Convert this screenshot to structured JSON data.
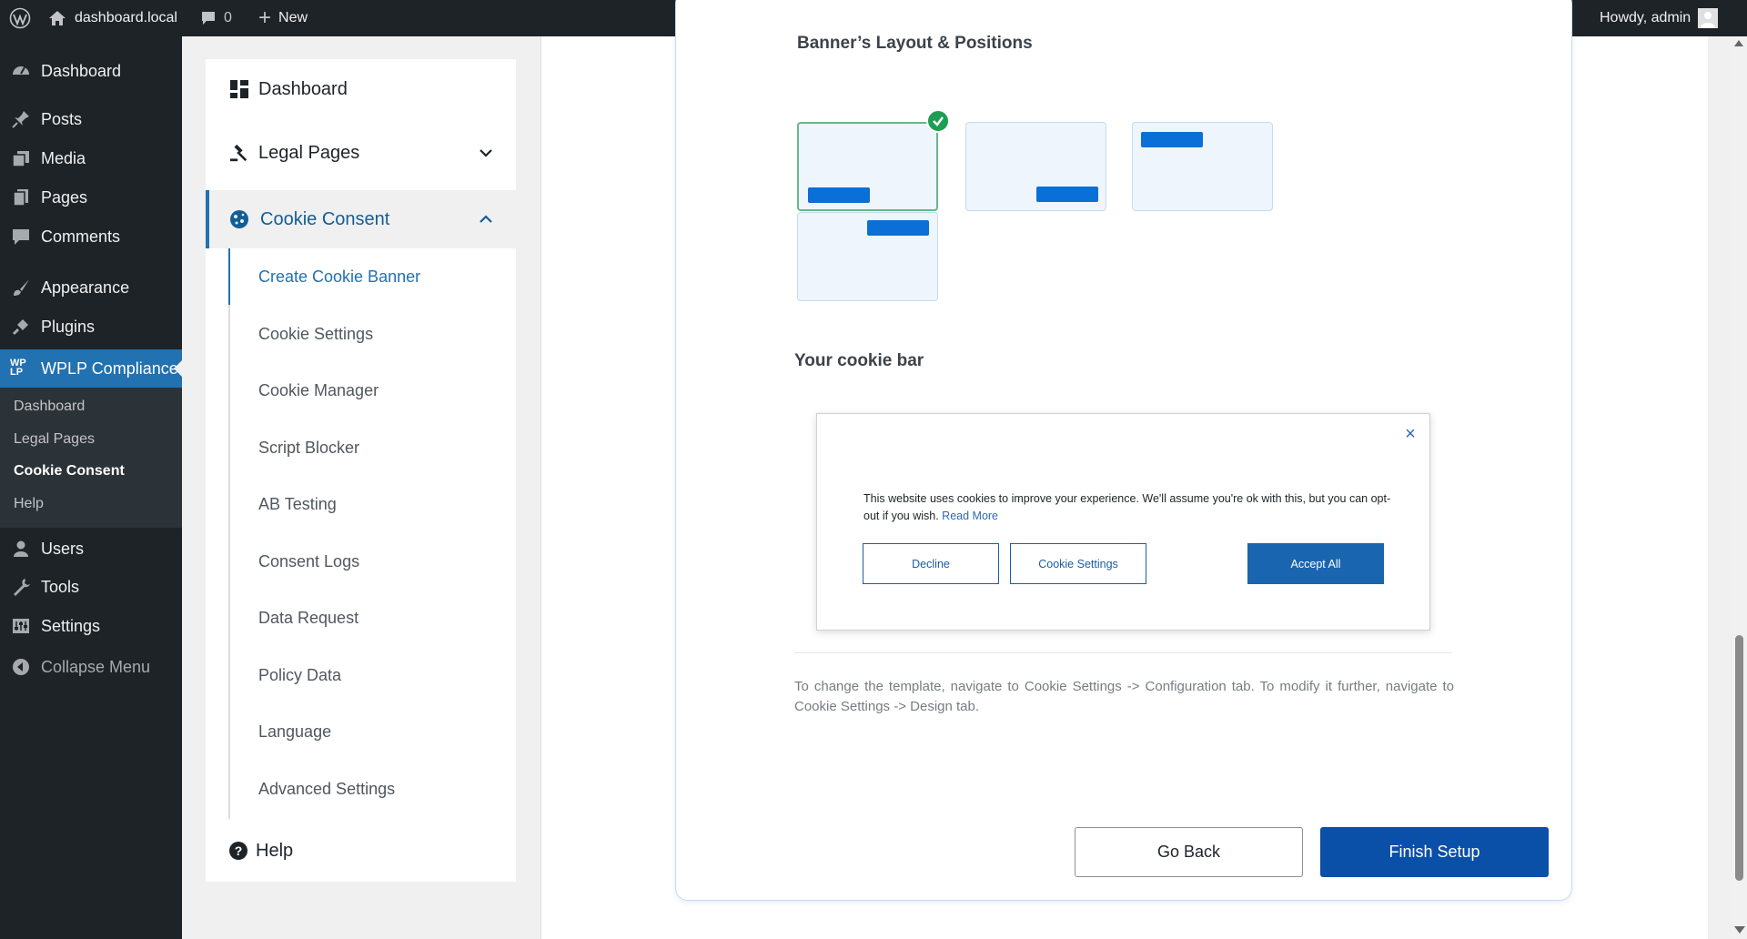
{
  "adminbar": {
    "site_name": "dashboard.local",
    "comments_count": "0",
    "new_label": "New",
    "howdy": "Howdy, admin"
  },
  "sidebar": {
    "items": [
      {
        "label": "Dashboard",
        "icon": "dashboard-icon"
      },
      {
        "label": "Posts",
        "icon": "pin-icon"
      },
      {
        "label": "Media",
        "icon": "media-icon"
      },
      {
        "label": "Pages",
        "icon": "pages-icon"
      },
      {
        "label": "Comments",
        "icon": "comment-icon"
      },
      {
        "label": "Appearance",
        "icon": "brush-icon"
      },
      {
        "label": "Plugins",
        "icon": "plug-icon"
      },
      {
        "label": "WPLP Compliance",
        "icon": "wplp-logo-icon"
      },
      {
        "label": "Users",
        "icon": "user-icon"
      },
      {
        "label": "Tools",
        "icon": "wrench-icon"
      },
      {
        "label": "Settings",
        "icon": "settings-icon"
      },
      {
        "label": "Collapse Menu",
        "icon": "collapse-icon"
      }
    ],
    "submenu": [
      "Dashboard",
      "Legal Pages",
      "Cookie Consent",
      "Help"
    ],
    "wplp_logo_text": "WP LP"
  },
  "plugin_nav": {
    "dashboard": "Dashboard",
    "legal_pages": "Legal Pages",
    "cookie_consent": "Cookie Consent",
    "cookie_sub": [
      "Create Cookie Banner",
      "Cookie Settings",
      "Cookie Manager",
      "Script Blocker",
      "AB Testing",
      "Consent Logs",
      "Data Request",
      "Policy Data",
      "Language",
      "Advanced Settings"
    ],
    "help": "Help"
  },
  "main": {
    "section_title": "Banner’s Layout & Positions",
    "cookie_bar_title": "Your cookie bar",
    "preview": {
      "close": "×",
      "text": "This website uses cookies to improve your experience. We'll assume you're ok with this, but you can opt-out if you wish.",
      "read_more": "Read More",
      "decline": "Decline",
      "cookie_settings": "Cookie Settings",
      "accept_all": "Accept All"
    },
    "info": "To change the template, navigate to Cookie Settings -> Configuration tab. To modify it further, navigate to Cookie Settings -> Design tab.",
    "go_back": "Go Back",
    "finish_setup": "Finish Setup"
  },
  "colors": {
    "accent": "#2271b1",
    "primary_button": "#0a4fa8",
    "layout_bar": "#0a6fd6",
    "check": "#1e9e55"
  }
}
